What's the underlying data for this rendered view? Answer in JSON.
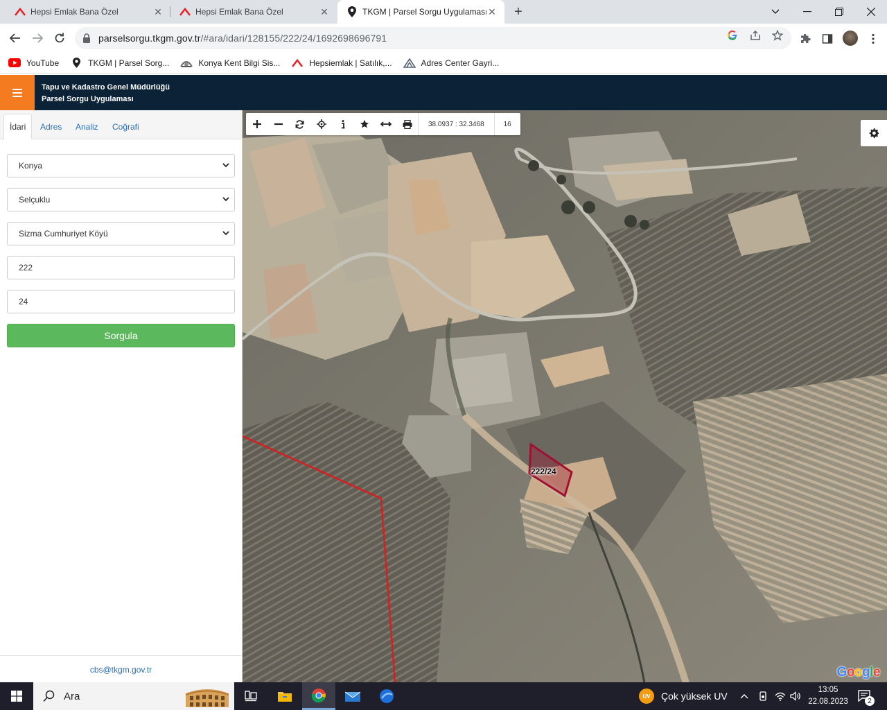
{
  "browser": {
    "tabs": [
      {
        "title": "Hepsi Emlak Bana Özel",
        "icon": "hepsiemlak-icon",
        "active": false
      },
      {
        "title": "Hepsi Emlak Bana Özel",
        "icon": "hepsiemlak-icon",
        "active": false
      },
      {
        "title": "TKGM | Parsel Sorgu Uygulaması",
        "icon": "map-pin-icon",
        "active": true
      }
    ],
    "url_host": "parselsorgu.tkgm.gov.tr",
    "url_path": "/#ara/idari/128155/222/24/1692698696791",
    "bookmarks": [
      {
        "label": "YouTube",
        "icon": "youtube-icon"
      },
      {
        "label": "TKGM | Parsel Sorg...",
        "icon": "map-pin-icon"
      },
      {
        "label": "Konya Kent Bilgi Sis...",
        "icon": "konya-icon"
      },
      {
        "label": "Hepsiemlak | Satılık,...",
        "icon": "hepsiemlak-icon"
      },
      {
        "label": "Adres Center Gayri...",
        "icon": "adres-center-icon"
      }
    ]
  },
  "app": {
    "title_line1": "Tapu ve Kadastro Genel Müdürlüğü",
    "title_line2": "Parsel Sorgu Uygulaması",
    "accent": "#f47b20",
    "header_bg": "#0b2237"
  },
  "sidebar": {
    "tabs": [
      "İdari",
      "Adres",
      "Analiz",
      "Coğrafi"
    ],
    "active_tab": "İdari",
    "il": "Konya",
    "ilce": "Selçuklu",
    "mahalle": "Sizma Cumhuriyet Köyü",
    "ada": "222",
    "parsel": "24",
    "query_button": "Sorgula",
    "footer_email": "cbs@tkgm.gov.tr"
  },
  "map": {
    "coordinates": "38.0937 : 32.3468",
    "zoom": "16",
    "parcel_label": "222/24",
    "attribution": "Google",
    "parcel_color": "#a01030"
  },
  "taskbar": {
    "search_placeholder": "Ara",
    "uv_badge": "UV",
    "uv_text": "Çok yüksek UV",
    "time": "13:05",
    "date": "22.08.2023",
    "notifications": "2"
  }
}
